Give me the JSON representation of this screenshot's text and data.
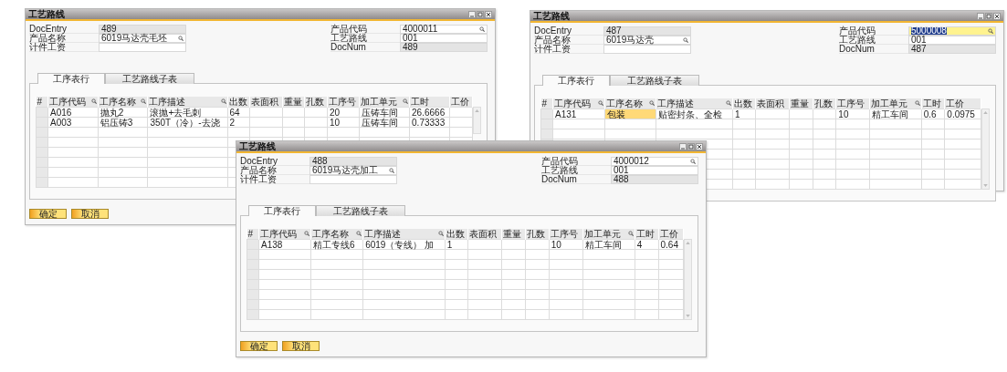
{
  "windows": [
    {
      "title": "工艺路线",
      "left_fields": [
        {
          "label": "DocEntry",
          "value": "489",
          "kind": "readonly",
          "focused": false
        },
        {
          "label": "产品名称",
          "value": "6019马达壳毛坯",
          "kind": "lookup",
          "focused": false
        },
        {
          "label": "计件工资",
          "kind": "text",
          "focused": false
        }
      ],
      "right_fields": [
        {
          "label": "产品代码",
          "value": "4000011",
          "kind": "lookup",
          "focused": false
        },
        {
          "label": "工艺路线",
          "value": "001",
          "kind": "text",
          "focused": false
        },
        {
          "label": "DocNum",
          "value": "489",
          "kind": "readonly",
          "focused": false
        }
      ],
      "tabs": [
        {
          "label": "工序表行",
          "selected": true
        },
        {
          "label": "工艺路线子表",
          "selected": false
        }
      ],
      "table": {
        "row_header": "#",
        "columns": [
          {
            "label": "工序代码",
            "lookup": true
          },
          {
            "label": "工序名称",
            "lookup": true
          },
          {
            "label": "工序描述",
            "lookup": true
          },
          {
            "label": "出数",
            "lookup": false
          },
          {
            "label": "表面积",
            "lookup": false
          },
          {
            "label": "重量",
            "lookup": false
          },
          {
            "label": "孔数",
            "lookup": false
          },
          {
            "label": "工序号",
            "lookup": false
          },
          {
            "label": "加工单元",
            "lookup": true
          },
          {
            "label": "工时",
            "lookup": false
          },
          {
            "label": "工价",
            "lookup": false
          }
        ],
        "rows": [
          {
            "cells": [
              "A016",
              "抛丸2",
              "滚抛+去毛刺",
              "64",
              null,
              null,
              null,
              "20",
              "压铸车间",
              "26.6666",
              null
            ]
          },
          {
            "cells": [
              "A003",
              "铝压铸3",
              "350T（冷）-去浇",
              "2",
              null,
              null,
              null,
              "10",
              "压铸车间",
              "0.73333",
              null
            ]
          }
        ]
      },
      "buttons": [
        "确定",
        "取消"
      ]
    },
    {
      "title": "工艺路线",
      "left_fields": [
        {
          "label": "DocEntry",
          "value": "487",
          "kind": "readonly",
          "focused": false
        },
        {
          "label": "产品名称",
          "value": "6019马达壳",
          "kind": "lookup",
          "focused": false
        },
        {
          "label": "计件工资",
          "kind": "text",
          "focused": false
        }
      ],
      "right_fields": [
        {
          "label": "产品代码",
          "value": "5000008",
          "kind": "lookup",
          "focused": true
        },
        {
          "label": "工艺路线",
          "value": "001",
          "kind": "text",
          "focused": false
        },
        {
          "label": "DocNum",
          "value": "487",
          "kind": "readonly",
          "focused": false
        }
      ],
      "tabs": [
        {
          "label": "工序表行",
          "selected": true
        },
        {
          "label": "工艺路线子表",
          "selected": false
        }
      ],
      "table": {
        "row_header": "#",
        "columns": [
          {
            "label": "工序代码",
            "lookup": true
          },
          {
            "label": "工序名称",
            "lookup": true
          },
          {
            "label": "工序描述",
            "lookup": true
          },
          {
            "label": "出数",
            "lookup": false
          },
          {
            "label": "表面积",
            "lookup": false
          },
          {
            "label": "重量",
            "lookup": false
          },
          {
            "label": "孔数",
            "lookup": false
          },
          {
            "label": "工序号",
            "lookup": false
          },
          {
            "label": "加工单元",
            "lookup": true
          },
          {
            "label": "工时",
            "lookup": false
          },
          {
            "label": "工价",
            "lookup": false
          }
        ],
        "rows": [
          {
            "cells": [
              "A131",
              {
                "text": "包装",
                "highlighted": true
              },
              "贴密封条、全检",
              "1",
              null,
              null,
              null,
              "10",
              "精工车间",
              "0.6",
              "0.0975"
            ]
          }
        ]
      }
    },
    {
      "title": "工艺路线",
      "left_fields": [
        {
          "label": "DocEntry",
          "value": "488",
          "kind": "readonly",
          "focused": false
        },
        {
          "label": "产品名称",
          "value": "6019马达壳加工",
          "kind": "lookup",
          "focused": false
        },
        {
          "label": "计件工资",
          "kind": "text",
          "focused": false
        }
      ],
      "right_fields": [
        {
          "label": "产品代码",
          "value": "4000012",
          "kind": "lookup",
          "focused": false
        },
        {
          "label": "工艺路线",
          "value": "001",
          "kind": "text",
          "focused": false
        },
        {
          "label": "DocNum",
          "value": "488",
          "kind": "readonly",
          "focused": false
        }
      ],
      "tabs": [
        {
          "label": "工序表行",
          "selected": true
        },
        {
          "label": "工艺路线子表",
          "selected": false
        }
      ],
      "table": {
        "row_header": "#",
        "columns": [
          {
            "label": "工序代码",
            "lookup": true
          },
          {
            "label": "工序名称",
            "lookup": true
          },
          {
            "label": "工序描述",
            "lookup": true
          },
          {
            "label": "出数",
            "lookup": false
          },
          {
            "label": "表面积",
            "lookup": false
          },
          {
            "label": "重量",
            "lookup": false
          },
          {
            "label": "孔数",
            "lookup": false
          },
          {
            "label": "工序号",
            "lookup": false
          },
          {
            "label": "加工单元",
            "lookup": true
          },
          {
            "label": "工时",
            "lookup": false
          },
          {
            "label": "工价",
            "lookup": false
          }
        ],
        "rows": [
          {
            "cells": [
              "A138",
              "精工专线6",
              "6019（专线） 加",
              "1",
              null,
              null,
              null,
              "10",
              "精工车间",
              "4",
              "0.64"
            ]
          }
        ]
      },
      "buttons": [
        "确定",
        "取消"
      ]
    }
  ]
}
